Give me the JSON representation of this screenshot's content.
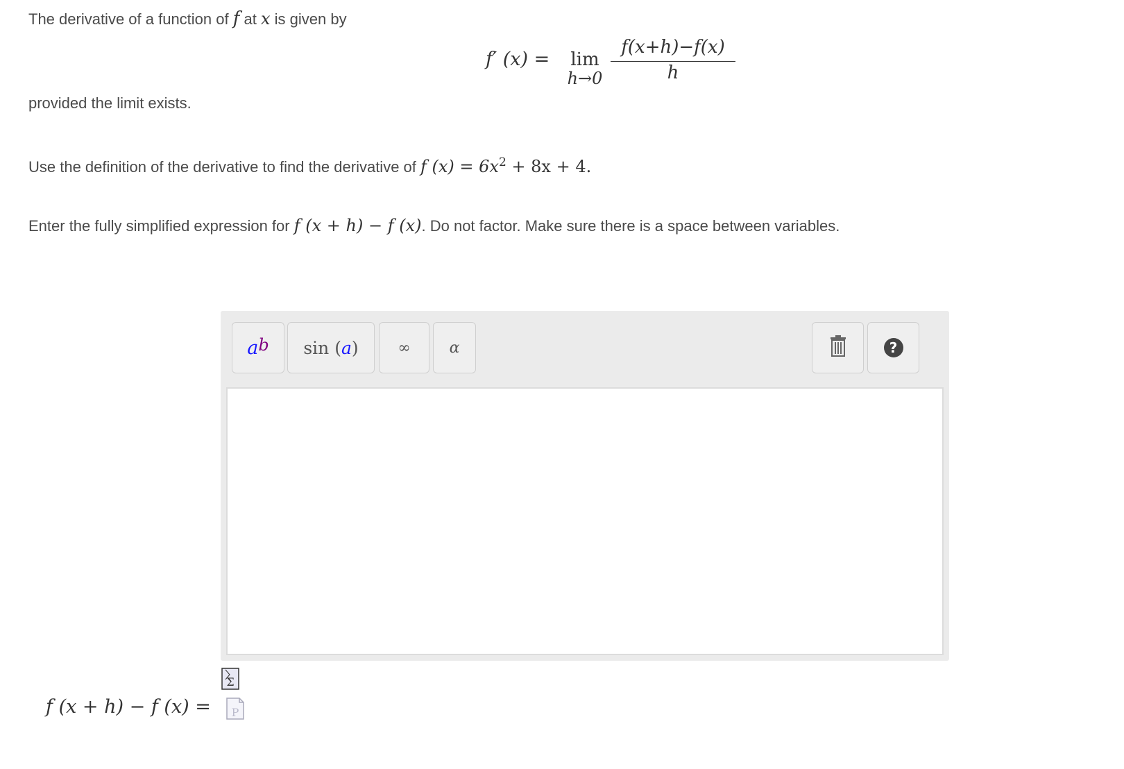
{
  "intro": {
    "text_a": "The derivative of a function of",
    "var_f": "f",
    "text_b": "at",
    "var_x": "x",
    "text_c": "is given by"
  },
  "definition": {
    "lhs": "f′ (x) =",
    "lim_word": "lim",
    "lim_sub": "h→0",
    "numerator": "f(x+h)−f(x)",
    "denominator": "h"
  },
  "provided": "provided the limit exists.",
  "question1": {
    "text": "Use the definition of the derivative to find the derivative of",
    "func": "f (x) = 6x",
    "exp": "2",
    "tail": " + 8x + 4",
    "period": "."
  },
  "question2": {
    "text": "Enter the fully simplified expression for",
    "expr": "f (x + h) − f (x)",
    "rest": ". Do not factor. Make sure there is a space between variables."
  },
  "toolbar": {
    "power_base": "a",
    "power_exp": "b",
    "sin_label": "sin",
    "sin_open": "(",
    "sin_arg": "a",
    "sin_close": ")",
    "infinity": "∞",
    "alpha": "α",
    "help": "?"
  },
  "answer": {
    "label": "f (x + h) − f (x) ="
  },
  "icons": {
    "sigma": "Σ",
    "preview": "P"
  },
  "colors": {
    "power_base": "#1a1aff",
    "power_exp": "#800080",
    "sin_arg": "#1a1aff"
  }
}
